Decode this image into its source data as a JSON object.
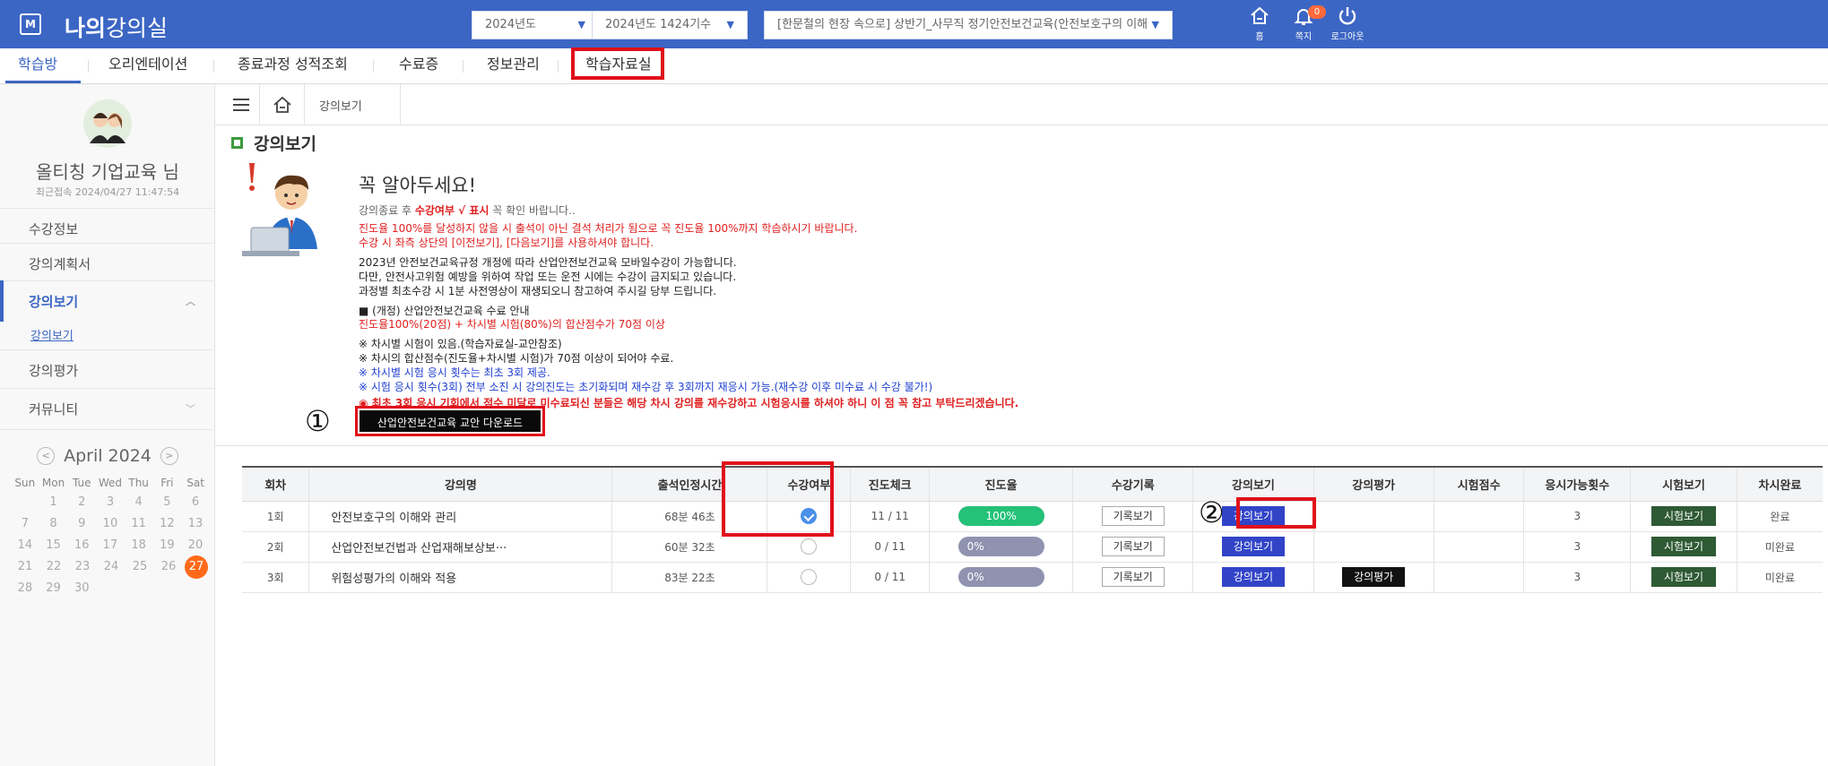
{
  "header": {
    "logo_glyph": "M",
    "title_bold": "나의",
    "title_rest": "강의실",
    "year_select": "2024년도",
    "term_select": "2024년도 1424기수",
    "course_select": "[한문철의 현장 속으로] 상반기_사무직 정기안전보건교육(안전보호구의 이해···",
    "home_label": "홈",
    "msg_label": "쪽지",
    "msg_badge": "0",
    "logout_label": "로그아웃",
    "accent_color": "#3c66c4"
  },
  "nav": {
    "items": [
      "학습방",
      "오리엔테이션",
      "종료과정 성적조회",
      "수료증",
      "정보관리",
      "학습자료실"
    ],
    "active": "학습방",
    "highlighted": "학습자료실"
  },
  "sidebar": {
    "user_name": "올티칭 기업교육 님",
    "last_login": "최근접속 2024/04/27 11:47:54",
    "menu": [
      "수강정보",
      "강의계획서",
      "강의보기",
      "강의보기",
      "강의평가",
      "커뮤니티"
    ]
  },
  "calendar": {
    "month": "April 2024",
    "weekdays": [
      "Sun",
      "Mon",
      "Tue",
      "Wed",
      "Thu",
      "Fri",
      "Sat"
    ],
    "weeks": [
      [
        "",
        "1",
        "2",
        "3",
        "4",
        "5",
        "6"
      ],
      [
        "7",
        "8",
        "9",
        "10",
        "11",
        "12",
        "13"
      ],
      [
        "14",
        "15",
        "16",
        "17",
        "18",
        "19",
        "20"
      ],
      [
        "21",
        "22",
        "23",
        "24",
        "25",
        "26",
        "27"
      ],
      [
        "28",
        "29",
        "30",
        "",
        "",
        "",
        ""
      ]
    ],
    "today": "27"
  },
  "breadcrumb": "강의보기",
  "page_title": "강의보기",
  "notice": {
    "title": "꼭 알아두세요!",
    "line1_pre": "강의종료 후 ",
    "line1_em": "수강여부 √ 표시",
    "line1_post": " 꼭 확인 바랍니다..",
    "line2": "진도율 100%를 달성하지 않을 시 출석이 아닌 결석 처리가 됨으로 꼭 진도율 100%까지 학습하시기 바랍니다.",
    "line3": "수강 시 좌측 상단의 [이전보기], [다음보기]를 사용하셔야 합니다.",
    "line4": "2023년 안전보건교육규정 개정에 따라 산업안전보건교육 모바일수강이 가능합니다.",
    "line5": "다만, 안전사고위험 예방을 위하여 작업 또는 운전 시에는 수강이 금지되고 있습니다.",
    "line6": "과정별 최초수강 시 1분 사전영상이 재생되오니 참고하여 주시길 당부 드립니다.",
    "line7": "■ (개정) 산업안전보건교육 수료 안내",
    "line8": "진도율100%(20점) + 차시별 시험(80%)의 합산점수가 70점 이상",
    "line9": "※ 차시별 시험이 있음.(학습자료실-교안참조)",
    "line10": "※ 차시의 합산점수(진도율+차시별 시험)가 70점 이상이 되어야 수료.",
    "line11": "※ 차시별 시험 응시 횟수는 최초 3회 제공.",
    "line12": "※ 시험 응시 횟수(3회) 전부 소진 시 강의진도는 초기화되며 재수강 후 3회까지 재응시 가능.(재수강 이후 미수료 시 수강 불가!)",
    "line13": "◉ 최초 3회 응시 기회에서 점수 미달로 미수료되신 분들은 해당 차시 강의를 재수강하고 시험응시를 하셔야 하니 이 점 꼭 참고 부탁드리겠습니다."
  },
  "download_button": "산업안전보건교육 교안 다운로드",
  "markers": {
    "one": "①",
    "two": "②"
  },
  "table": {
    "headers": [
      "회차",
      "강의명",
      "출석인정시간",
      "수강여부",
      "진도체크",
      "진도율",
      "수강기록",
      "강의보기",
      "강의평가",
      "시험점수",
      "응시가능횟수",
      "시험보기",
      "차시완료"
    ],
    "rows": [
      {
        "no": "1회",
        "title": "안전보호구의 이해와 관리",
        "time": "68분 46초",
        "attended": true,
        "check": "11 / 11",
        "progress_pct": 100,
        "progress": "100%",
        "record": "기록보기",
        "view": "강의보기",
        "eval": "",
        "score": "",
        "attempts": "3",
        "exam": "시험보기",
        "done": "완료"
      },
      {
        "no": "2회",
        "title": "산업안전보건법과 산업재해보상보···",
        "time": "60분 32초",
        "attended": false,
        "check": "0 / 11",
        "progress_pct": 0,
        "progress": "0%",
        "record": "기록보기",
        "view": "강의보기",
        "eval": "",
        "score": "",
        "attempts": "3",
        "exam": "시험보기",
        "done": "미완료"
      },
      {
        "no": "3회",
        "title": "위험성평가의 이해와 적용",
        "time": "83분 22초",
        "attended": false,
        "check": "0 / 11",
        "progress_pct": 0,
        "progress": "0%",
        "record": "기록보기",
        "view": "강의보기",
        "eval": "강의평가",
        "score": "",
        "attempts": "3",
        "exam": "시험보기",
        "done": "미완료"
      }
    ]
  }
}
